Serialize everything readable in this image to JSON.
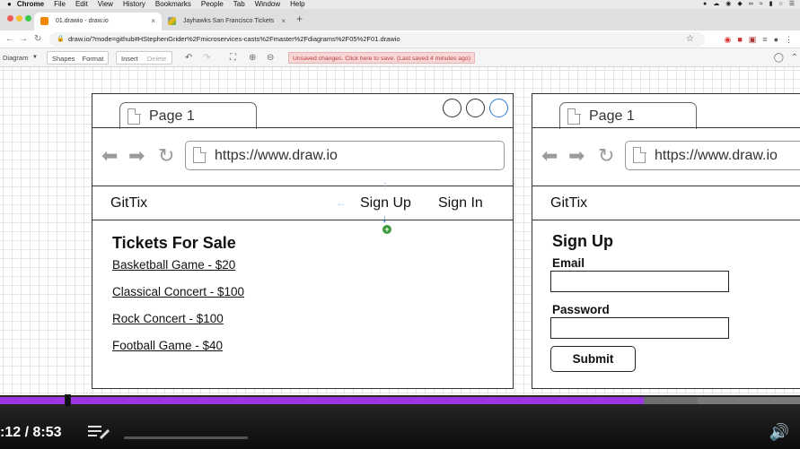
{
  "mac_menubar": {
    "app": "Chrome",
    "items": [
      "File",
      "Edit",
      "View",
      "History",
      "Bookmarks",
      "People",
      "Tab",
      "Window",
      "Help"
    ]
  },
  "browser": {
    "tabs": [
      {
        "title": "01.drawio - draw.io",
        "close": "×"
      },
      {
        "title": "Jayhawks San Francisco Tickets",
        "close": "×"
      }
    ],
    "new_tab": "+",
    "url": "draw.io/?mode=github#HStephenGrider%2Fmicroservices-casts%2Fmaster%2Fdiagrams%2F05%2F01.drawio"
  },
  "drawio_toolbar": {
    "diagram": "Diagram",
    "shapes": "Shapes",
    "format": "Format",
    "insert": "Insert",
    "delete": "Delete",
    "unsaved": "Unsaved changes. Click here to save. (Last saved 4 minutes ago)"
  },
  "mockup_left": {
    "page_tab": "Page 1",
    "url": "https://www.draw.io",
    "brand": "GitTix",
    "nav_signup": "Sign Up",
    "nav_signin": "Sign In",
    "heading": "Tickets For Sale",
    "tickets": [
      "Basketball Game - $20",
      "Classical Concert - $100",
      "Rock Concert - $100",
      "Football Game - $40"
    ]
  },
  "mockup_right": {
    "page_tab": "Page 1",
    "url": "https://www.draw.io",
    "brand": "GitTix",
    "heading": "Sign Up",
    "email_label": "Email",
    "password_label": "Password",
    "submit": "Submit"
  },
  "video": {
    "time": ":12 / 8:53",
    "progress_pct": 80.5,
    "colors": {
      "progress": "#9d35e0"
    }
  }
}
